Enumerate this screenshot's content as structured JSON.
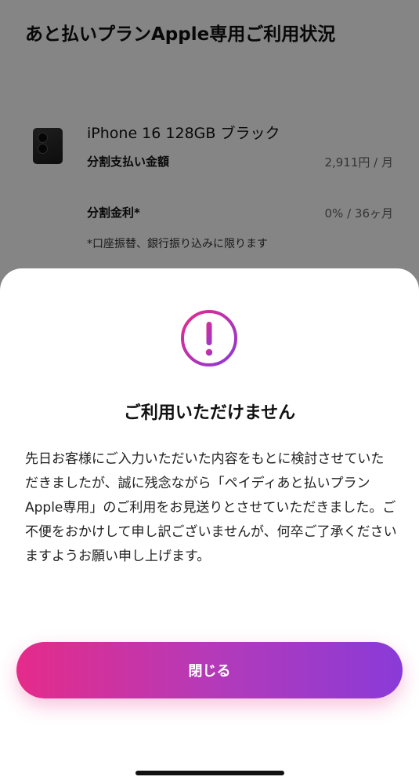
{
  "background": {
    "title": "あと払いプランApple専用ご利用状況",
    "product_name": "iPhone 16 128GB ブラック",
    "installment_label": "分割支払い金額",
    "installment_value": "2,911円 / 月",
    "interest_label": "分割金利*",
    "interest_value": "0% / 36ヶ月",
    "note": "*口座振替、銀行振り込みに限ります"
  },
  "dialog": {
    "icon": "exclamation-circle-icon",
    "title": "ご利用いただけません",
    "message": "先日お客様にご入力いただいた内容をもとに検討させていただきましたが、誠に残念ながら「ペイディあと払いプランApple専用」のご利用をお見送りとさせていただきました。ご不便をおかけして申し訳ございませんが、何卒ご了承くださいますようお願い申し上げます。",
    "close_label": "閉じる"
  },
  "colors": {
    "accent_start": "#e52b8a",
    "accent_end": "#8a3ad8"
  }
}
